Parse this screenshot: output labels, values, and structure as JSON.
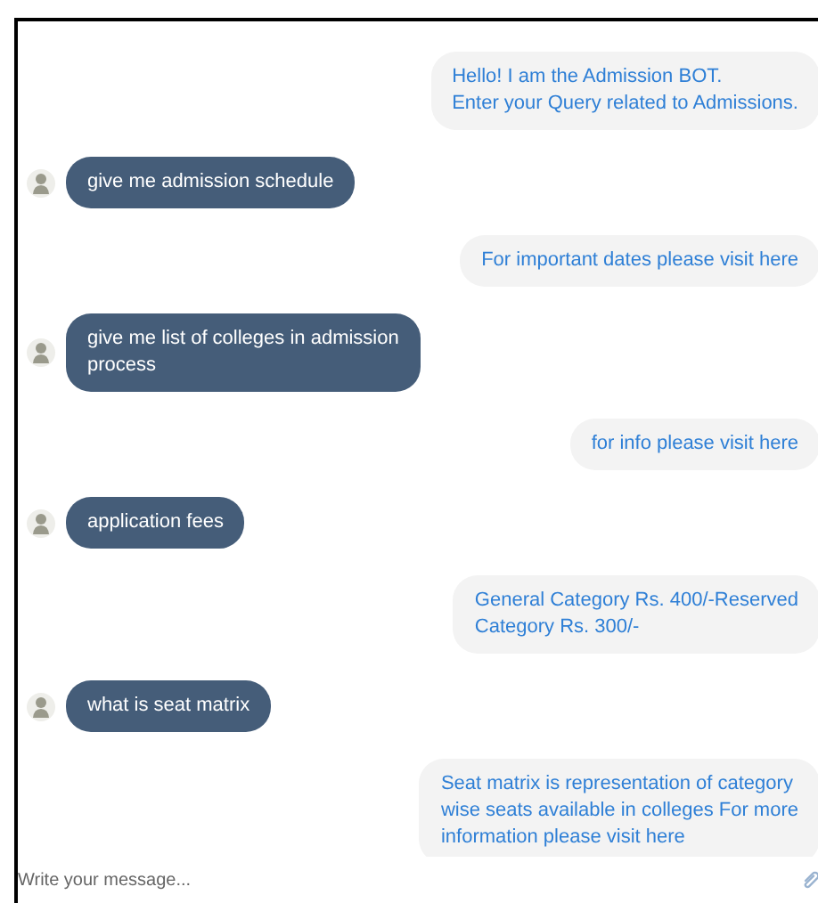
{
  "messages": [
    {
      "kind": "bot",
      "text": "Hello! I am the Admission BOT.\nEnter your Query related to Admissions."
    },
    {
      "kind": "user",
      "text": "give me admission schedule"
    },
    {
      "kind": "bot",
      "text": "For important dates please visit here"
    },
    {
      "kind": "user",
      "text": "give me list of colleges in admission\nprocess"
    },
    {
      "kind": "bot",
      "text": "for info please visit here"
    },
    {
      "kind": "user",
      "text": "application fees"
    },
    {
      "kind": "bot",
      "text": "General Category Rs. 400/-Reserved\nCategory Rs. 300/-"
    },
    {
      "kind": "user",
      "text": "what is seat matrix"
    },
    {
      "kind": "bot",
      "text": "Seat matrix is representation of category\nwise seats available in colleges For more\ninformation please visit here"
    }
  ],
  "composer": {
    "placeholder": "Write your message..."
  }
}
